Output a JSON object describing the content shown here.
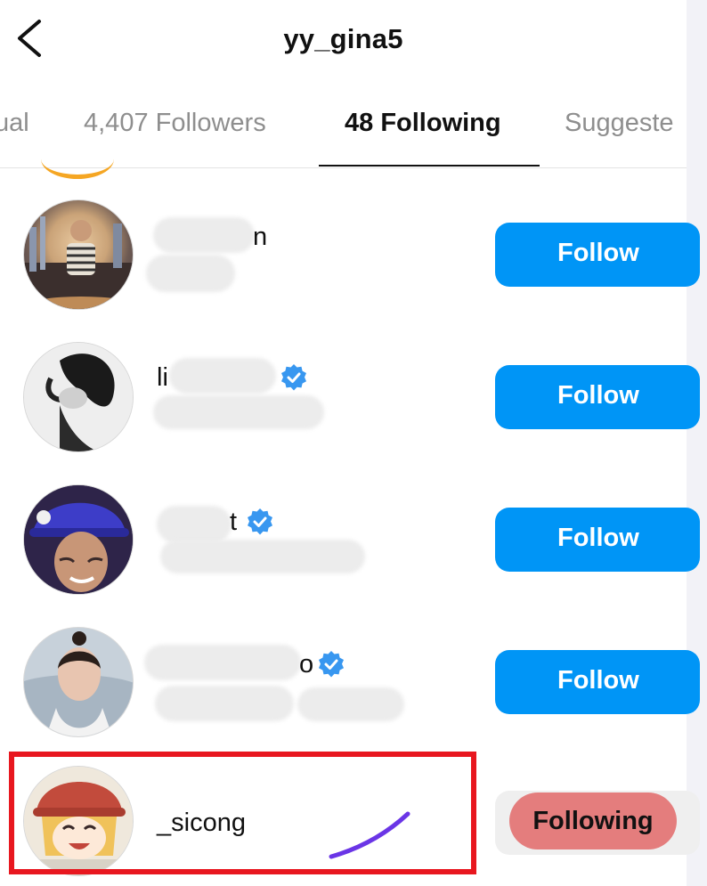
{
  "header": {
    "title": "yy_gina5"
  },
  "tabs": [
    {
      "label": "ual"
    },
    {
      "label": "4,407 Followers"
    },
    {
      "label": "48 Following"
    },
    {
      "label": "Suggeste"
    }
  ],
  "list": [
    {
      "username_fragment": "n",
      "verified": false,
      "button": "Follow"
    },
    {
      "username_fragment": "li",
      "verified": true,
      "button": "Follow"
    },
    {
      "username_fragment": "t",
      "verified": true,
      "button": "Follow"
    },
    {
      "username_fragment": "o",
      "verified": true,
      "button": "Follow"
    },
    {
      "username": "_sicong",
      "verified": false,
      "button": "Following",
      "highlighted": true
    }
  ],
  "colors": {
    "follow_button": "#0095f6",
    "following_button": "#e47d7d",
    "highlight_box": "#e8171f",
    "verified_badge": "#3897f0",
    "annotation_stroke": "#6a35e6"
  },
  "icons": [
    "back-chevron-icon",
    "verified-badge-icon"
  ]
}
